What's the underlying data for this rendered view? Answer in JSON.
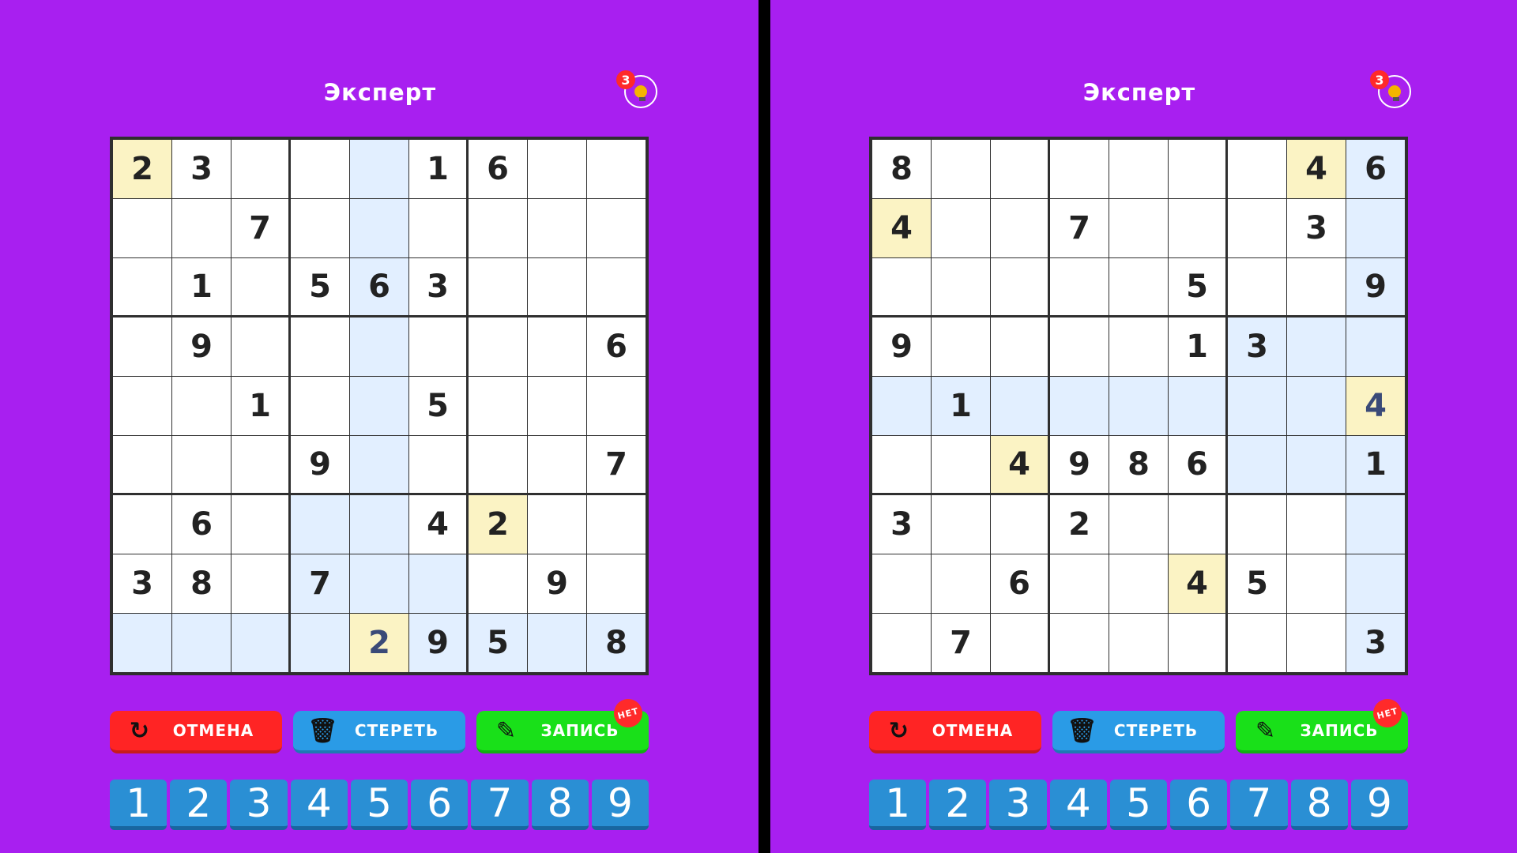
{
  "panels": [
    {
      "title": "Эксперт",
      "hints": "3",
      "selected": [
        [
          0,
          0
        ],
        [
          6,
          6
        ],
        [
          8,
          4
        ]
      ],
      "highlight": [
        [
          0,
          4
        ],
        [
          1,
          4
        ],
        [
          2,
          4
        ],
        [
          3,
          4
        ],
        [
          4,
          4
        ],
        [
          5,
          4
        ],
        [
          6,
          3
        ],
        [
          6,
          4
        ],
        [
          7,
          3
        ],
        [
          7,
          4
        ],
        [
          7,
          5
        ],
        [
          8,
          0
        ],
        [
          8,
          1
        ],
        [
          8,
          2
        ],
        [
          8,
          3
        ],
        [
          8,
          5
        ],
        [
          8,
          6
        ],
        [
          8,
          7
        ],
        [
          8,
          8
        ]
      ],
      "user": [
        [
          8,
          4
        ]
      ],
      "grid": [
        [
          "2",
          "3",
          "",
          "",
          "",
          "1",
          "6",
          "",
          ""
        ],
        [
          "",
          "",
          "7",
          "",
          "",
          "",
          "",
          "",
          ""
        ],
        [
          "",
          "1",
          "",
          "5",
          "6",
          "3",
          "",
          "",
          ""
        ],
        [
          "",
          "9",
          "",
          "",
          "",
          "",
          "",
          "",
          "6"
        ],
        [
          "",
          "",
          "1",
          "",
          "",
          "5",
          "",
          "",
          ""
        ],
        [
          "",
          "",
          "",
          "9",
          "",
          "",
          "",
          "",
          "7"
        ],
        [
          "",
          "6",
          "",
          "",
          "",
          "4",
          "2",
          "",
          ""
        ],
        [
          "3",
          "8",
          "",
          "7",
          "",
          "",
          "",
          "9",
          ""
        ],
        [
          "",
          "",
          "",
          "",
          "2",
          "9",
          "5",
          "",
          "8"
        ]
      ],
      "buttons": {
        "undo": "ОТМЕНА",
        "erase": "СТЕРЕТЬ",
        "note": "ЗАПИСЬ",
        "note_state": "НЕТ"
      },
      "digits": [
        "1",
        "2",
        "3",
        "4",
        "5",
        "6",
        "7",
        "8",
        "9"
      ]
    },
    {
      "title": "Эксперт",
      "hints": "3",
      "selected": [
        [
          0,
          7
        ],
        [
          1,
          0
        ],
        [
          4,
          8
        ],
        [
          5,
          2
        ],
        [
          7,
          5
        ]
      ],
      "highlight": [
        [
          0,
          8
        ],
        [
          1,
          8
        ],
        [
          2,
          8
        ],
        [
          3,
          6
        ],
        [
          3,
          7
        ],
        [
          3,
          8
        ],
        [
          4,
          0
        ],
        [
          4,
          1
        ],
        [
          4,
          2
        ],
        [
          4,
          3
        ],
        [
          4,
          4
        ],
        [
          4,
          5
        ],
        [
          4,
          6
        ],
        [
          4,
          7
        ],
        [
          5,
          6
        ],
        [
          5,
          7
        ],
        [
          5,
          8
        ],
        [
          6,
          8
        ],
        [
          7,
          8
        ],
        [
          8,
          8
        ]
      ],
      "user": [
        [
          4,
          8
        ]
      ],
      "grid": [
        [
          "8",
          "",
          "",
          "",
          "",
          "",
          "",
          "4",
          "6"
        ],
        [
          "4",
          "",
          "",
          "7",
          "",
          "",
          "",
          "3",
          ""
        ],
        [
          "",
          "",
          "",
          "",
          "",
          "5",
          "",
          "",
          "9"
        ],
        [
          "9",
          "",
          "",
          "",
          "",
          "1",
          "3",
          "",
          ""
        ],
        [
          "",
          "1",
          "",
          "",
          "",
          "",
          "",
          "",
          "4"
        ],
        [
          "",
          "",
          "4",
          "9",
          "8",
          "6",
          "",
          "",
          "1"
        ],
        [
          "3",
          "",
          "",
          "2",
          "",
          "",
          "",
          "",
          ""
        ],
        [
          "",
          "",
          "6",
          "",
          "",
          "4",
          "5",
          "",
          ""
        ],
        [
          "",
          "7",
          "",
          "",
          "",
          "",
          "",
          "",
          "3"
        ]
      ],
      "buttons": {
        "undo": "ОТМЕНА",
        "erase": "СТЕРЕТЬ",
        "note": "ЗАПИСЬ",
        "note_state": "НЕТ"
      },
      "digits": [
        "1",
        "2",
        "3",
        "4",
        "5",
        "6",
        "7",
        "8",
        "9"
      ]
    }
  ],
  "colors": {
    "background": "#a81ff0",
    "undo": "#ff2424",
    "erase": "#2a9be6",
    "note": "#19e019",
    "digit": "#2a8fd4"
  }
}
